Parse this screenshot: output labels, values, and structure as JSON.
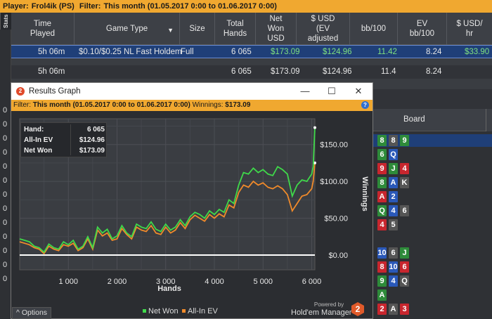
{
  "topbar": {
    "player_label": "Player:",
    "player": "Frol4ik (PS)",
    "filter_label": "Filter:",
    "filter": "This month (01.05.2017 0:00 to 01.06.2017 0:00)"
  },
  "stats_tab": "Stats",
  "columns": [
    {
      "label": "Time\nPlayed"
    },
    {
      "label": "Game Type"
    },
    {
      "label": "Size"
    },
    {
      "label": "Total\nHands"
    },
    {
      "label": "Net\nWon\nUSD"
    },
    {
      "label": "$ USD\n(EV\nadjusted"
    },
    {
      "label": "bb/100"
    },
    {
      "label": "EV\nbb/100"
    },
    {
      "label": "$ USD/\nhr"
    }
  ],
  "rows": [
    {
      "time": "5h 06m",
      "game": "$0.10/$0.25 NL Fast Holdem",
      "size": "Full",
      "hands": "6 065",
      "net": "$173.09",
      "ev": "$124.96",
      "bb": "11.42",
      "evbb": "8.24",
      "hr": "$33.90"
    },
    {
      "time": "5h 06m",
      "game": "",
      "size": "",
      "hands": "6 065",
      "net": "$173.09",
      "ev": "$124.96",
      "bb": "11.4",
      "evbb": "8.24",
      "hr": ""
    }
  ],
  "graph_window": {
    "title": "Results Graph",
    "filter_label": "Filter:",
    "filter": "This month (01.05.2017 0:00 to 01.06.2017 0:00)",
    "winnings_label": "Winnings:",
    "winnings": "$173.09",
    "stats": [
      {
        "label": "Hand:",
        "value": "6 065"
      },
      {
        "label": "All-In EV",
        "value": "$124.96"
      },
      {
        "label": "Net Won",
        "value": "$173.09"
      }
    ],
    "options_label": "Options",
    "legend": [
      {
        "name": "Net Won",
        "color": "#3fd94a"
      },
      {
        "name": "All-In EV",
        "color": "#f08a2a"
      }
    ],
    "powered_by": "Powered by",
    "brand": "Hold'em Manager",
    "brand_icon": "hm2-logo-icon"
  },
  "chart_data": {
    "type": "line",
    "xlabel": "Hands",
    "ylabel": "Winnings",
    "xlim": [
      0,
      6065
    ],
    "ylim": [
      -20,
      185
    ],
    "x_ticks": [
      "1 000",
      "2 000",
      "3 000",
      "4 000",
      "5 000",
      "6 000"
    ],
    "y_ticks": [
      "$0.00",
      "$50.00",
      "$100.00",
      "$150.00"
    ],
    "grid": true,
    "series": [
      {
        "name": "Net Won",
        "color": "#3fd94a",
        "x": [
          0,
          100,
          200,
          300,
          400,
          500,
          600,
          700,
          800,
          900,
          1000,
          1100,
          1200,
          1300,
          1400,
          1500,
          1600,
          1700,
          1800,
          1900,
          2000,
          2100,
          2200,
          2300,
          2400,
          2500,
          2600,
          2700,
          2800,
          2900,
          3000,
          3100,
          3200,
          3300,
          3400,
          3500,
          3600,
          3700,
          3800,
          3900,
          4000,
          4100,
          4200,
          4300,
          4400,
          4500,
          4600,
          4700,
          4800,
          4900,
          5000,
          5100,
          5200,
          5300,
          5400,
          5500,
          5600,
          5700,
          5800,
          5900,
          6000,
          6030,
          6065
        ],
        "y": [
          22,
          20,
          18,
          12,
          10,
          4,
          15,
          10,
          8,
          18,
          14,
          20,
          8,
          12,
          25,
          10,
          38,
          30,
          35,
          22,
          26,
          40,
          30,
          25,
          42,
          38,
          36,
          45,
          35,
          32,
          42,
          34,
          38,
          48,
          40,
          52,
          58,
          55,
          50,
          60,
          55,
          62,
          58,
          75,
          70,
          95,
          112,
          110,
          118,
          112,
          116,
          110,
          108,
          120,
          116,
          110,
          80,
          95,
          102,
          100,
          110,
          120,
          173
        ]
      },
      {
        "name": "All-In EV",
        "color": "#f08a2a",
        "x": [
          0,
          100,
          200,
          300,
          400,
          500,
          600,
          700,
          800,
          900,
          1000,
          1100,
          1200,
          1300,
          1400,
          1500,
          1600,
          1700,
          1800,
          1900,
          2000,
          2100,
          2200,
          2300,
          2400,
          2500,
          2600,
          2700,
          2800,
          2900,
          3000,
          3100,
          3200,
          3300,
          3400,
          3500,
          3600,
          3700,
          3800,
          3900,
          4000,
          4100,
          4200,
          4300,
          4400,
          4500,
          4600,
          4700,
          4800,
          4900,
          5000,
          5100,
          5200,
          5300,
          5400,
          5500,
          5600,
          5700,
          5800,
          5900,
          6000,
          6030,
          6065
        ],
        "y": [
          18,
          16,
          14,
          10,
          8,
          2,
          12,
          8,
          6,
          14,
          12,
          16,
          6,
          10,
          22,
          8,
          34,
          26,
          30,
          20,
          22,
          36,
          28,
          22,
          38,
          34,
          32,
          40,
          30,
          28,
          38,
          30,
          34,
          44,
          36,
          48,
          54,
          50,
          46,
          55,
          50,
          56,
          52,
          68,
          64,
          85,
          95,
          92,
          100,
          95,
          98,
          92,
          90,
          94,
          90,
          82,
          60,
          70,
          80,
          82,
          90,
          100,
          125
        ]
      }
    ]
  },
  "board": {
    "header": "Board",
    "rows": [
      {
        "cards": [
          {
            "r": "",
            "c": "k"
          },
          {
            "r": "8",
            "c": "g"
          },
          {
            "r": "8",
            "c": "k"
          },
          {
            "r": "9",
            "c": "g"
          }
        ],
        "sel": true
      },
      {
        "cards": [
          {
            "r": "",
            "c": "b"
          },
          {
            "r": "6",
            "c": "g"
          },
          {
            "r": "Q",
            "c": "b"
          }
        ]
      },
      {
        "cards": [
          {
            "r": "",
            "c": "g"
          },
          {
            "r": "9",
            "c": "r"
          },
          {
            "r": "J",
            "c": "g"
          },
          {
            "r": "4",
            "c": "r"
          }
        ]
      },
      {
        "cards": [
          {
            "r": "",
            "c": "b"
          },
          {
            "r": "8",
            "c": "g"
          },
          {
            "r": "A",
            "c": "b"
          },
          {
            "r": "K",
            "c": "k"
          }
        ]
      },
      {
        "cards": [
          {
            "r": "",
            "c": "b"
          },
          {
            "r": "A",
            "c": "r"
          },
          {
            "r": "2",
            "c": "b"
          }
        ]
      },
      {
        "cards": [
          {
            "r": "",
            "c": "b"
          },
          {
            "r": "Q",
            "c": "g"
          },
          {
            "r": "4",
            "c": "b"
          },
          {
            "r": "6",
            "c": "k"
          }
        ]
      },
      {
        "cards": [
          {
            "r": "",
            "c": "b"
          },
          {
            "r": "4",
            "c": "r"
          },
          {
            "r": "5",
            "c": "k"
          }
        ]
      },
      {
        "cards": []
      },
      {
        "cards": [
          {
            "r": "",
            "c": "k"
          },
          {
            "r": "10",
            "c": "b"
          },
          {
            "r": "6",
            "c": "k"
          },
          {
            "r": "J",
            "c": "g"
          }
        ]
      },
      {
        "cards": [
          {
            "r": "",
            "c": "b"
          },
          {
            "r": "8",
            "c": "r"
          },
          {
            "r": "10",
            "c": "b"
          },
          {
            "r": "6",
            "c": "r"
          }
        ]
      },
      {
        "cards": [
          {
            "r": "",
            "c": "k"
          },
          {
            "r": "9",
            "c": "g"
          },
          {
            "r": "4",
            "c": "b"
          },
          {
            "r": "Q",
            "c": "k"
          }
        ]
      },
      {
        "cards": [
          {
            "r": "",
            "c": "b"
          },
          {
            "r": "A",
            "c": "g"
          }
        ]
      },
      {
        "cards": [
          {
            "r": "",
            "c": "b"
          },
          {
            "r": "2",
            "c": "r"
          },
          {
            "r": "A",
            "c": "k"
          },
          {
            "r": "3",
            "c": "r"
          }
        ]
      }
    ]
  }
}
